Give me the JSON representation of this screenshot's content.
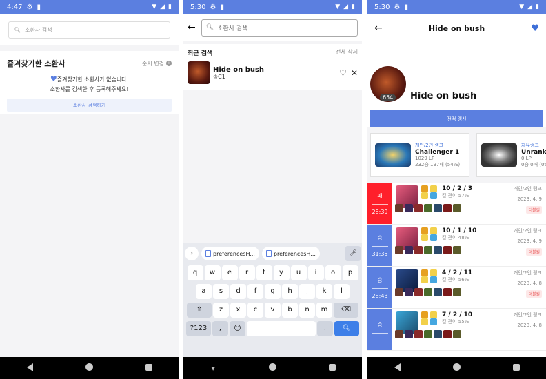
{
  "phone1": {
    "status": {
      "time": "4:47"
    },
    "search_placeholder": "소환사 검색",
    "fav_title": "즐겨찾기한 소환사",
    "fav_order": "순서 변경",
    "fav_empty_line1": "즐겨찾기한 소환사가 없습니다.",
    "fav_empty_line2": "소환사를 검색한 후 등록해주세요!",
    "fav_button": "소환사 검색하기"
  },
  "phone2": {
    "status": {
      "time": "5:30"
    },
    "search_placeholder": "소환사 검색",
    "recent_title": "최근 검색",
    "clear_all": "전체 삭제",
    "recent_item": {
      "name": "Hide on bush",
      "tier": "C1"
    },
    "keyboard": {
      "suggestions": [
        "preferencesH...",
        "preferencesH..."
      ],
      "row1": [
        "q",
        "w",
        "e",
        "r",
        "t",
        "y",
        "u",
        "i",
        "o",
        "p"
      ],
      "row1_sup": [
        "1",
        "2",
        "3",
        "4",
        "5",
        "6",
        "7",
        "8",
        "9",
        "0"
      ],
      "row2": [
        "a",
        "s",
        "d",
        "f",
        "g",
        "h",
        "j",
        "k",
        "l"
      ],
      "row3": [
        "z",
        "x",
        "c",
        "v",
        "b",
        "n",
        "m"
      ],
      "symbols": "?123",
      "comma": ",",
      "period": "."
    }
  },
  "phone3": {
    "status": {
      "time": "5:30"
    },
    "title": "Hide on bush",
    "summoner_name": "Hide on bush",
    "level": "654",
    "refresh_button": "전적 갱신",
    "ranks": [
      {
        "queue": "개인/2인 랭크",
        "tier": "Challenger 1",
        "lp": "1029 LP",
        "record": "232승 197패 (54%)"
      },
      {
        "queue": "자유랭크",
        "tier": "Unrank",
        "lp": "0 LP",
        "record": "0승 0패 (0%)"
      }
    ],
    "matches": [
      {
        "result": "패",
        "duration": "28:39",
        "kda": "10 / 2 / 3",
        "kp": "킬 관여 57%",
        "queue": "개인/2인 랭크",
        "date": "2023. 4. 9",
        "tag": "더블킬",
        "win": false
      },
      {
        "result": "승",
        "duration": "31:35",
        "kda": "10 / 1 / 10",
        "kp": "킬 관여 48%",
        "queue": "개인/2인 랭크",
        "date": "2023. 4. 9",
        "tag": "더블킬",
        "win": true
      },
      {
        "result": "승",
        "duration": "28:43",
        "kda": "4 / 2 / 11",
        "kp": "킬 관여 56%",
        "queue": "개인/2인 랭크",
        "date": "2023. 4. 8",
        "tag": "더블킬",
        "win": true
      },
      {
        "result": "승",
        "duration": "",
        "kda": "7 / 2 / 10",
        "kp": "킬 관여 55%",
        "queue": "개인/2인 랭크",
        "date": "2023. 4. 8",
        "tag": "",
        "win": true
      }
    ]
  },
  "colors": {
    "accent": "#5b7fe0",
    "lose": "#ff1f2b"
  }
}
